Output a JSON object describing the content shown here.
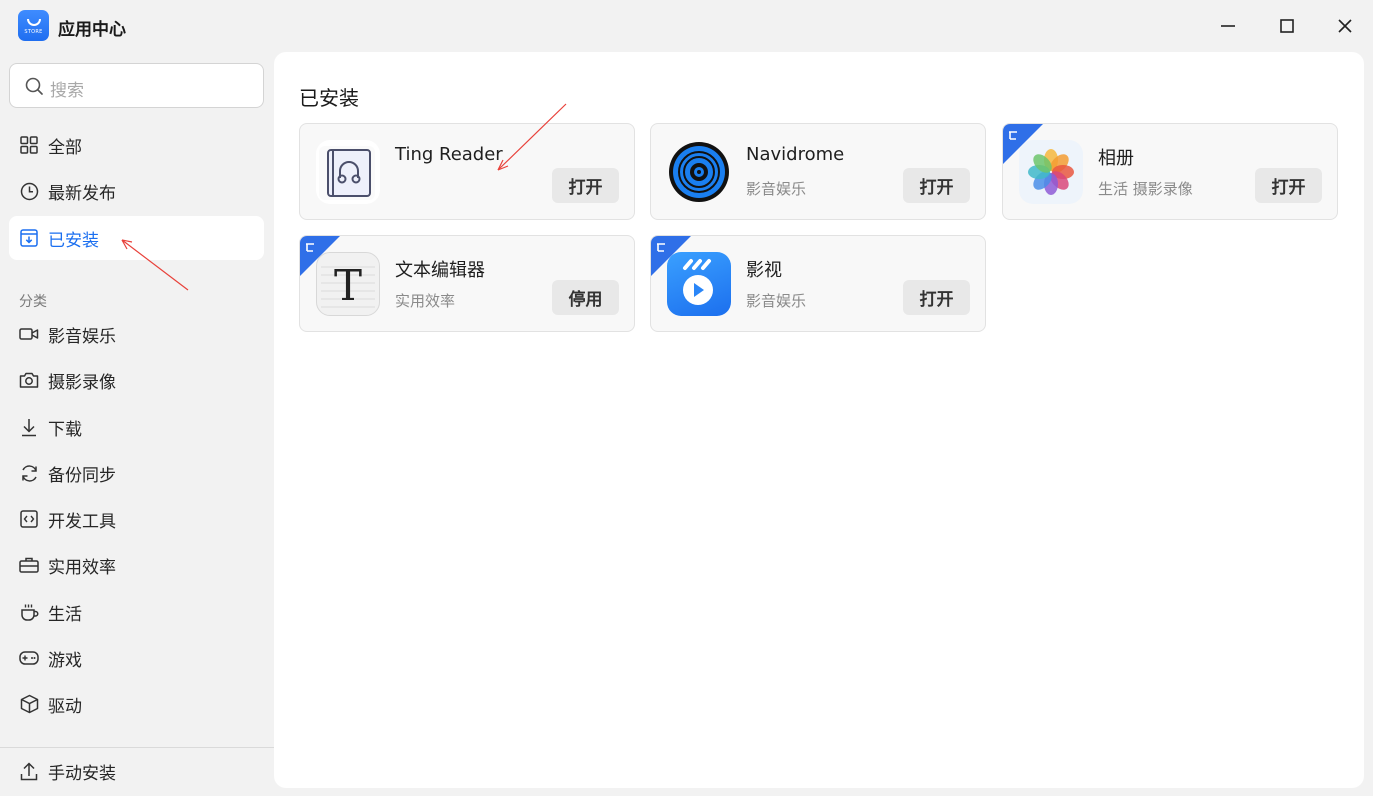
{
  "app": {
    "title": "应用中心",
    "logo_text": "STORE",
    "accent": "#1b6ff0",
    "window_controls": [
      "minimize-icon",
      "maximize-icon",
      "close-icon"
    ]
  },
  "search": {
    "placeholder": "搜索",
    "icon": "search-icon"
  },
  "sidebar": {
    "items": [
      {
        "label": "全部",
        "icon": "grid-icon"
      },
      {
        "label": "最新发布",
        "icon": "clock-icon"
      },
      {
        "label": "已安装",
        "icon": "installed-icon",
        "active": true
      }
    ],
    "category_title": "分类",
    "categories": [
      {
        "label": "影音娱乐",
        "icon": "video-icon"
      },
      {
        "label": "摄影录像",
        "icon": "camera-icon"
      },
      {
        "label": "下载",
        "icon": "download-icon"
      },
      {
        "label": "备份同步",
        "icon": "sync-icon"
      },
      {
        "label": "开发工具",
        "icon": "code-icon"
      },
      {
        "label": "实用效率",
        "icon": "toolbox-icon"
      },
      {
        "label": "生活",
        "icon": "cup-icon"
      },
      {
        "label": "游戏",
        "icon": "gamepad-icon"
      },
      {
        "label": "驱动",
        "icon": "cube-icon"
      }
    ],
    "manual_install": {
      "label": "手动安装",
      "icon": "upload-icon"
    }
  },
  "main": {
    "section_title": "已安装",
    "apps": [
      {
        "name": "Ting Reader",
        "category": "",
        "action": "打开",
        "icon": "ting-reader-icon",
        "badge": false
      },
      {
        "name": "Navidrome",
        "category": "影音娱乐",
        "action": "打开",
        "icon": "navidrome-icon",
        "badge": false
      },
      {
        "name": "相册",
        "category": "生活 摄影录像",
        "action": "打开",
        "icon": "photos-icon",
        "badge": true
      },
      {
        "name": "文本编辑器",
        "category": "实用效率",
        "action": "停用",
        "icon": "text-editor-icon",
        "badge": true
      },
      {
        "name": "影视",
        "category": "影音娱乐",
        "action": "打开",
        "icon": "video-app-icon",
        "badge": true
      }
    ]
  }
}
